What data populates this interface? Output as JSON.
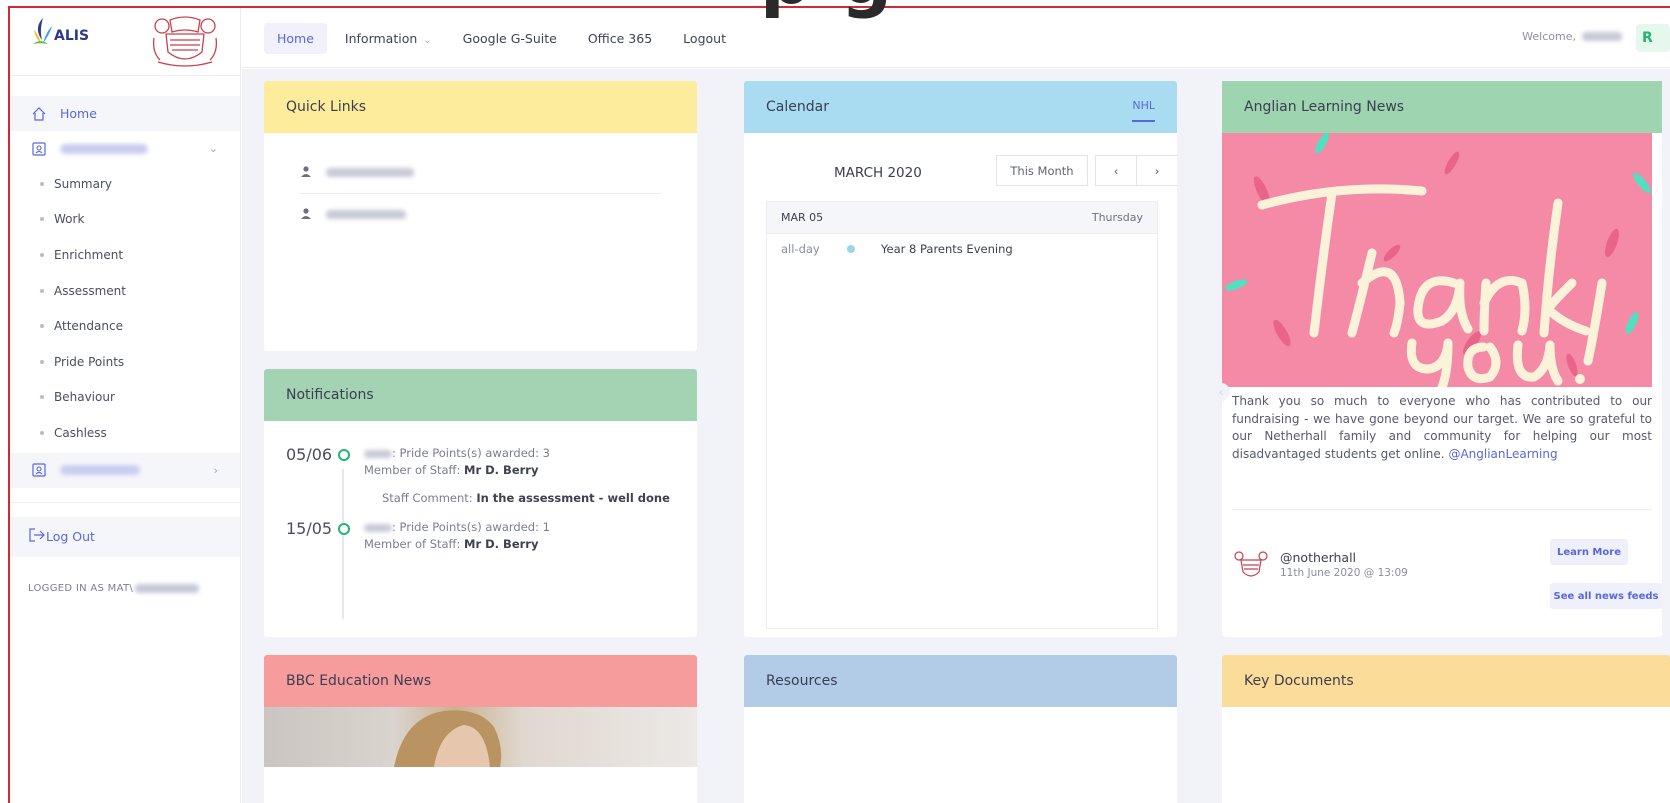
{
  "header_glyph": "p g",
  "brand": {
    "logo_text": "ALIS"
  },
  "topnav": {
    "items": [
      {
        "label": "Home",
        "active": true
      },
      {
        "label": "Information",
        "dropdown": true
      },
      {
        "label": "Google G-Suite"
      },
      {
        "label": "Office 365"
      },
      {
        "label": "Logout"
      }
    ],
    "welcome_label": "Welcome,",
    "avatar_initial": "R"
  },
  "sidebar": {
    "home_label": "Home",
    "sub_items": [
      "Summary",
      "Work",
      "Enrichment",
      "Assessment",
      "Attendance",
      "Pride Points",
      "Behaviour",
      "Cashless"
    ],
    "logout_label": "Log Out",
    "logged_in_label": "LOGGED IN AS MAT\\"
  },
  "quick_links": {
    "title": "Quick Links"
  },
  "notifications": {
    "title": "Notifications",
    "entries": [
      {
        "date": "05/06",
        "points_text": ": Pride Points(s) awarded: 3",
        "staff_label": "Member of Staff:",
        "staff_name": "Mr D. Berry",
        "comment_label": "Staff Comment:",
        "comment": "In the assessment - well done"
      },
      {
        "date": "15/05",
        "points_text": ": Pride Points(s) awarded: 1",
        "staff_label": "Member of Staff:",
        "staff_name": "Mr D. Berry"
      }
    ]
  },
  "calendar": {
    "title": "Calendar",
    "tab": "NHL",
    "month": "MARCH 2020",
    "this_month_label": "This Month",
    "prev_icon": "‹",
    "next_icon": "›",
    "day": {
      "date": "MAR 05",
      "weekday": "Thursday"
    },
    "events": [
      {
        "time": "all-day",
        "title": "Year 8 Parents Evening",
        "color": "#9fd3e6"
      }
    ]
  },
  "news": {
    "title": "Anglian Learning News",
    "image_text": [
      "Thank",
      "You!"
    ],
    "body": "Thank you so much to everyone who has contributed to our fundraising - we have gone beyond our target. We are so grateful to our Netherhall family and community for helping our most disadvantaged students get online.",
    "mention": "@AnglianLearning",
    "author_handle": "@notherhall",
    "author_date": "11th June 2020 @ 13:09",
    "learn_more_label": "Learn More",
    "see_all_label": "See all news feeds"
  },
  "bbc": {
    "title": "BBC Education News"
  },
  "resources": {
    "title": "Resources"
  },
  "key_documents": {
    "title": "Key Documents"
  },
  "colors": {
    "accent": "#5867dd",
    "quick_links_head": "#fdec9b",
    "calendar_head": "#a9dcf0",
    "news_head": "#9fd4b0",
    "notifications_head": "#a3d3b2",
    "bbc_head": "#f79c9c",
    "resources_head": "#b2cbe6",
    "key_docs_head": "#fbdc98",
    "frame": "#d12a35"
  }
}
